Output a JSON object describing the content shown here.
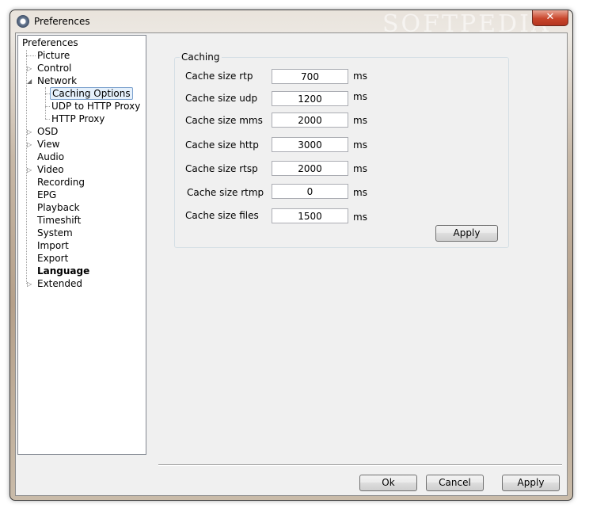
{
  "window": {
    "title": "Preferences",
    "close_label": "✕",
    "watermark": "SOFTPEDIA"
  },
  "tree": {
    "items": [
      {
        "label": "Preferences"
      },
      {
        "label": "Picture"
      },
      {
        "label": "Control"
      },
      {
        "label": "Network"
      },
      {
        "label": "Caching Options"
      },
      {
        "label": "UDP to HTTP Proxy"
      },
      {
        "label": "HTTP Proxy"
      },
      {
        "label": "OSD"
      },
      {
        "label": "View"
      },
      {
        "label": "Audio"
      },
      {
        "label": "Video"
      },
      {
        "label": "Recording"
      },
      {
        "label": "EPG"
      },
      {
        "label": "Playback"
      },
      {
        "label": "Timeshift"
      },
      {
        "label": "System"
      },
      {
        "label": "Import"
      },
      {
        "label": "Export"
      },
      {
        "label": "Language"
      },
      {
        "label": "Extended"
      }
    ],
    "selected": "Caching Options"
  },
  "caching": {
    "title": "Caching",
    "rows": [
      {
        "label": "Cache size rtp",
        "value": "700",
        "unit": "ms"
      },
      {
        "label": "Cache size udp",
        "value": "1200",
        "unit": "ms"
      },
      {
        "label": "Cache size mms",
        "value": "2000",
        "unit": "ms"
      },
      {
        "label": "Cache size http",
        "value": "3000",
        "unit": "ms"
      },
      {
        "label": "Cache size rtsp",
        "value": "2000",
        "unit": "ms"
      },
      {
        "label": "Cache size rtmp",
        "value": "0",
        "unit": "ms"
      },
      {
        "label": "Cache size files",
        "value": "1500",
        "unit": "ms"
      }
    ],
    "apply_label": "Apply"
  },
  "footer": {
    "ok_label": "Ok",
    "cancel_label": "Cancel",
    "apply_label": "Apply"
  }
}
